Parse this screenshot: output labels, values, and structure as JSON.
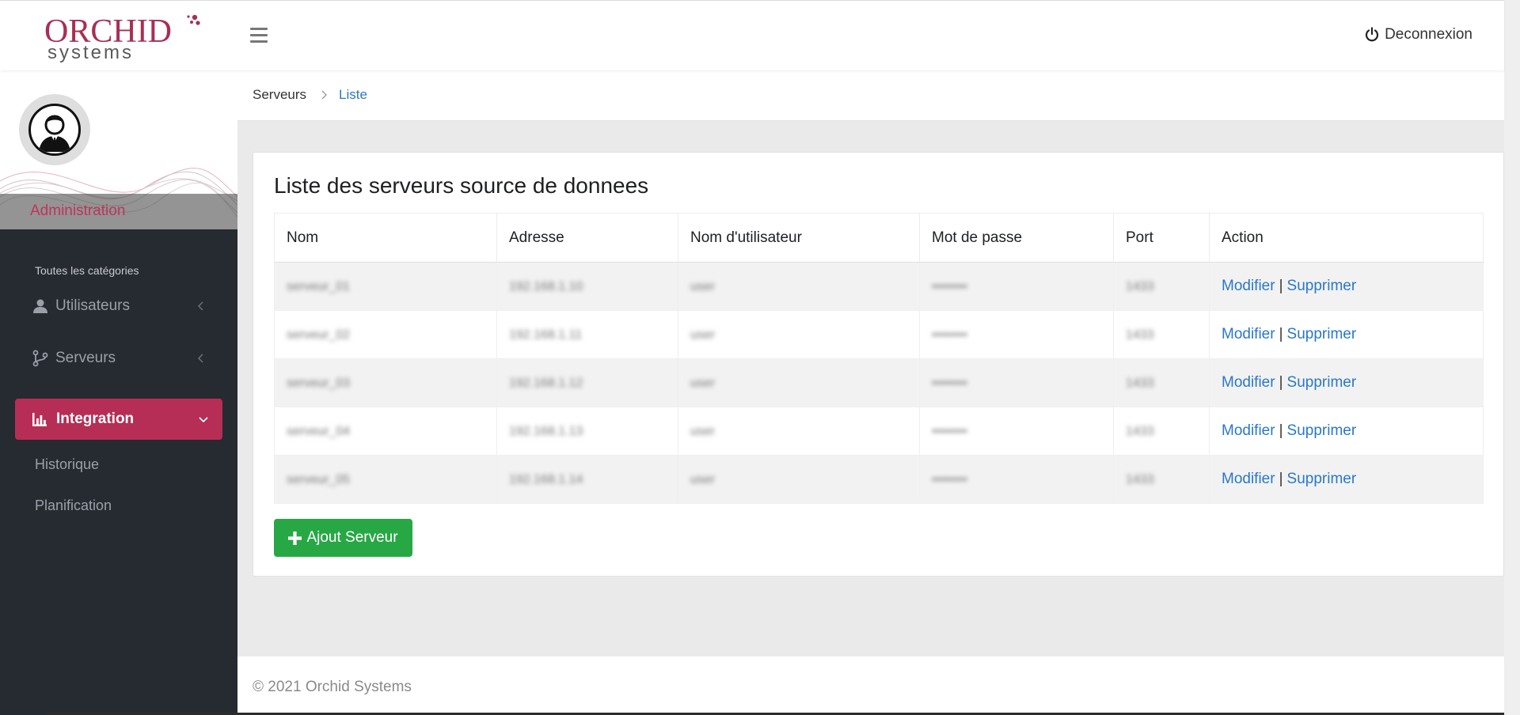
{
  "header": {
    "logo_word1": "ORCHID",
    "logo_word2": "systems",
    "logout_label": "Deconnexion"
  },
  "sidebar": {
    "role": "Administration",
    "category_title": "Toutes les catégories",
    "items": [
      {
        "label": "Utilisateurs",
        "icon": "user-icon"
      },
      {
        "label": "Serveurs",
        "icon": "branch-icon"
      },
      {
        "label": "Integration",
        "icon": "bar-chart-icon",
        "active": true
      }
    ],
    "subitems": [
      {
        "label": "Historique"
      },
      {
        "label": "Planification"
      }
    ]
  },
  "breadcrumb": {
    "items": [
      "Serveurs",
      "Liste"
    ]
  },
  "main": {
    "title": "Liste des serveurs source de donnees",
    "columns": [
      "Nom",
      "Adresse",
      "Nom d'utilisateur",
      "Mot de passe",
      "Port",
      "Action"
    ],
    "rows": [
      {
        "nom": "serveur_01",
        "adresse": "192.168.1.10",
        "user": "user",
        "pass": "••••••••",
        "port": "1433"
      },
      {
        "nom": "serveur_02",
        "adresse": "192.168.1.11",
        "user": "user",
        "pass": "••••••••",
        "port": "1433"
      },
      {
        "nom": "serveur_03",
        "adresse": "192.168.1.12",
        "user": "user",
        "pass": "••••••••",
        "port": "1433"
      },
      {
        "nom": "serveur_04",
        "adresse": "192.168.1.13",
        "user": "user",
        "pass": "••••••••",
        "port": "1433"
      },
      {
        "nom": "serveur_05",
        "adresse": "192.168.1.14",
        "user": "user",
        "pass": "••••••••",
        "port": "1433"
      }
    ],
    "action_edit": "Modifier",
    "action_sep": "|",
    "action_delete": "Supprimer",
    "add_button": "Ajout Serveur"
  },
  "footer": {
    "copyright": "© 2021 Orchid Systems"
  },
  "colors": {
    "brand": "#b62e55",
    "sidebar_bg": "#262a31",
    "link": "#2a78c8",
    "success": "#28a745"
  }
}
